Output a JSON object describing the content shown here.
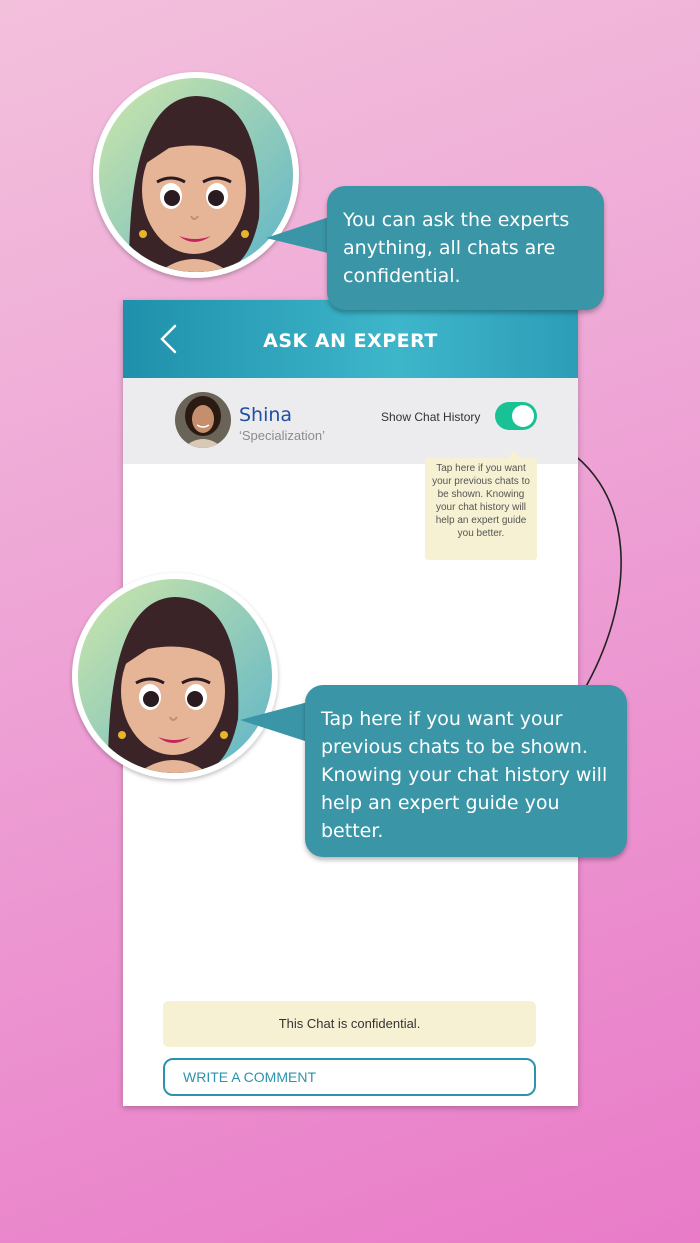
{
  "header": {
    "title": "ASK AN EXPERT"
  },
  "expert": {
    "name": "Shina",
    "specialization": "‘Specialization’"
  },
  "chat_history": {
    "label": "Show Chat History",
    "enabled": true
  },
  "tooltip": {
    "text": "Tap here if you want your previous chats to be shown. Knowing your chat history will help an expert guide you better."
  },
  "confidential": {
    "text": "This Chat is confidential."
  },
  "comment": {
    "label": "WRITE A COMMENT"
  },
  "bubble_top": {
    "text": "You can ask the experts anything, all chats are confidential."
  },
  "bubble_bottom": {
    "text": "Tap here if you want your previous chats to be shown. Knowing your chat history will help an expert guide you better."
  },
  "colors": {
    "teal": "#3a95a6",
    "toggle_green": "#19c295",
    "expert_name": "#1d4fa3",
    "note_bg": "#f6f1d3"
  }
}
